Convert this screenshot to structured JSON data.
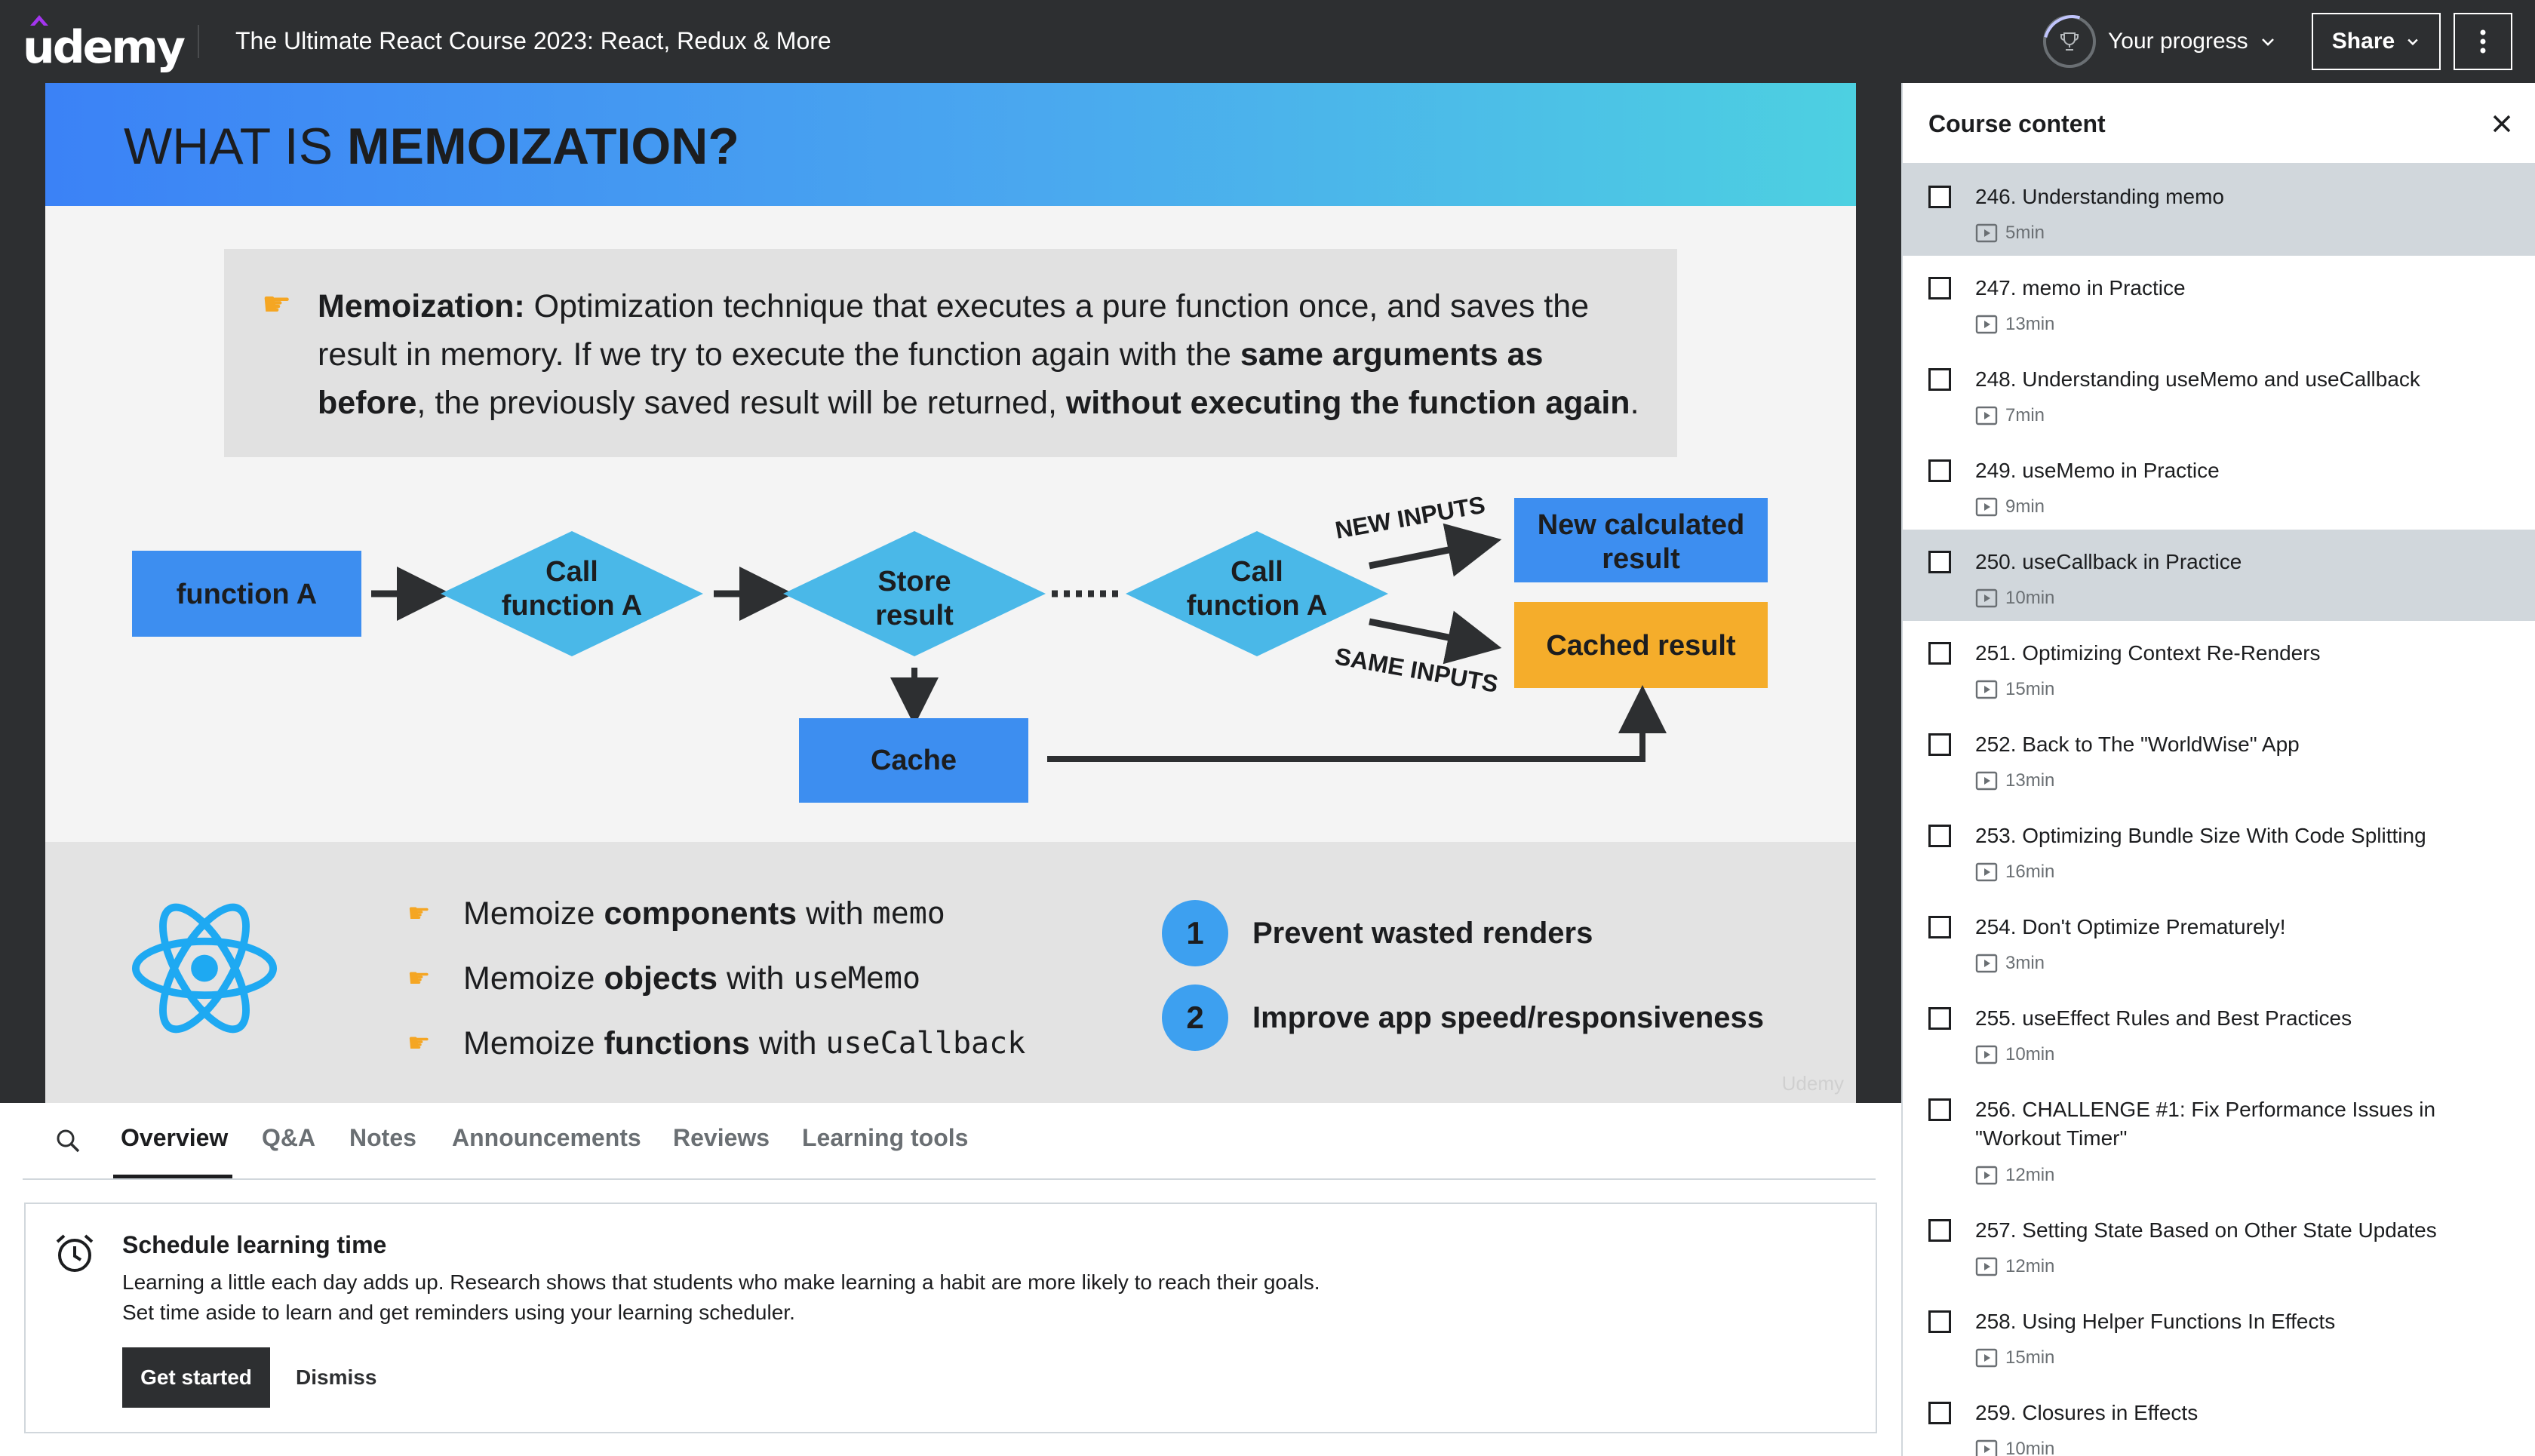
{
  "header": {
    "logo_text": "udemy",
    "course_title": "The Ultimate React Course 2023: React, Redux & More",
    "progress_label": "Your progress",
    "share_label": "Share"
  },
  "slide": {
    "title_plain": "WHAT IS",
    "title_bold": "MEMOIZATION?",
    "definition": {
      "term": "Memoization:",
      "text1": " Optimization technique that executes a pure function once, and saves the result in memory. If we try to execute the function again with the ",
      "bold1": "same arguments as before",
      "text2": ", the previously saved result will be returned, ",
      "bold2": "without executing the function again",
      "text3": "."
    },
    "diagram": {
      "function_a": "function A",
      "call_line1": "Call",
      "call_line2": "function A",
      "store_line1": "Store",
      "store_line2": "result",
      "cache": "Cache",
      "new_inputs": "NEW INPUTS",
      "same_inputs": "SAME INPUTS",
      "new_result_line1": "New calculated",
      "new_result_line2": "result",
      "cached_result": "Cached result"
    },
    "memo_items": [
      {
        "pre": "Memoize",
        "bold": "components",
        "mid": "with",
        "code": "memo"
      },
      {
        "pre": "Memoize",
        "bold": "objects",
        "mid": "with",
        "code": "useMemo"
      },
      {
        "pre": "Memoize",
        "bold": "functions",
        "mid": "with",
        "code": "useCallback"
      }
    ],
    "goals": [
      {
        "num": "1",
        "text": "Prevent wasted renders"
      },
      {
        "num": "2",
        "text": "Improve app speed/responsiveness"
      }
    ],
    "watermark": "Udemy"
  },
  "tabs": [
    {
      "label": "Overview",
      "active": true
    },
    {
      "label": "Q&A",
      "active": false
    },
    {
      "label": "Notes",
      "active": false
    },
    {
      "label": "Announcements",
      "active": false
    },
    {
      "label": "Reviews",
      "active": false
    },
    {
      "label": "Learning tools",
      "active": false
    }
  ],
  "schedule": {
    "title": "Schedule learning time",
    "line1": "Learning a little each day adds up. Research shows that students who make learning a habit are more likely to reach their goals.",
    "line2": "Set time aside to learn and get reminders using your learning scheduler.",
    "primary_label": "Get started",
    "dismiss_label": "Dismiss"
  },
  "sidebar": {
    "title": "Course content",
    "lectures": [
      {
        "title": "246. Understanding memo",
        "duration": "5min",
        "selected": true
      },
      {
        "title": "247. memo in Practice",
        "duration": "13min",
        "selected": false
      },
      {
        "title": "248. Understanding useMemo and useCallback",
        "duration": "7min",
        "selected": false
      },
      {
        "title": "249. useMemo in Practice",
        "duration": "9min",
        "selected": false
      },
      {
        "title": "250. useCallback in Practice",
        "duration": "10min",
        "selected": true
      },
      {
        "title": "251. Optimizing Context Re-Renders",
        "duration": "15min",
        "selected": false
      },
      {
        "title": "252. Back to The \"WorldWise\" App",
        "duration": "13min",
        "selected": false
      },
      {
        "title": "253. Optimizing Bundle Size With Code Splitting",
        "duration": "16min",
        "selected": false
      },
      {
        "title": "254. Don't Optimize Prematurely!",
        "duration": "3min",
        "selected": false
      },
      {
        "title": "255. useEffect Rules and Best Practices",
        "duration": "10min",
        "selected": false
      },
      {
        "title": "256. CHALLENGE #1: Fix Performance Issues in \"Workout Timer\"",
        "duration": "12min",
        "selected": false
      },
      {
        "title": "257. Setting State Based on Other State Updates",
        "duration": "12min",
        "selected": false
      },
      {
        "title": "258. Using Helper Functions In Effects",
        "duration": "15min",
        "selected": false
      },
      {
        "title": "259. Closures in Effects",
        "duration": "10min",
        "selected": false
      }
    ]
  },
  "colors": {
    "header_bg": "#2d2f31",
    "accent_purple": "#a435f0",
    "slide_blue": "#3b82f6",
    "diamond_cyan": "#4ab8e8",
    "cached_orange": "#f5ad2b",
    "selected_row": "#d1d7dc"
  }
}
